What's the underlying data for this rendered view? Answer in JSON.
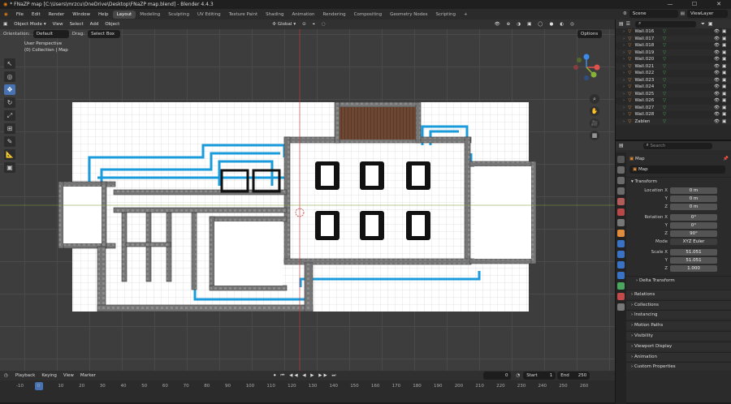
{
  "window": {
    "title": "* FNaZP map [C:\\Users\\mrzcu\\OneDrive\\Desktop\\FNaZP map.blend] - Blender 4.4.3"
  },
  "menu": [
    "File",
    "Edit",
    "Render",
    "Window",
    "Help"
  ],
  "workspaces": [
    "Layout",
    "Modeling",
    "Sculpting",
    "UV Editing",
    "Texture Paint",
    "Shading",
    "Animation",
    "Rendering",
    "Compositing",
    "Geometry Nodes",
    "Scripting",
    "+"
  ],
  "scene": {
    "name": "Scene",
    "view_layer": "ViewLayer"
  },
  "viewport_header": {
    "mode": "Object Mode",
    "view": "View",
    "select": "Select",
    "add": "Add",
    "object": "Object",
    "orientation_global": "Global"
  },
  "viewport_header2": {
    "orientation_label": "Orientation:",
    "orientation": "Default",
    "drag_label": "Drag:",
    "drag": "Select Box",
    "options": "Options"
  },
  "viewport_info": {
    "perspective": "User Perspective",
    "collection": "(0) Collection | Map"
  },
  "outliner": {
    "search_placeholder": "",
    "items": [
      "Wall.016",
      "Wall.017",
      "Wall.018",
      "Wall.019",
      "Wall.020",
      "Wall.021",
      "Wall.022",
      "Wall.023",
      "Wall.024",
      "Wall.025",
      "Wall.026",
      "Wall.027",
      "Wall.028",
      "Zablen"
    ]
  },
  "properties": {
    "search_placeholder": "Search",
    "object_name": "Map",
    "data_name": "Map",
    "transform_label": "Transform",
    "location": {
      "label": "Location X",
      "x": "0 m",
      "y": "0 m",
      "z": "0 m"
    },
    "rotation": {
      "label": "Rotation X",
      "x": "0°",
      "y": "0°",
      "z": "90°"
    },
    "mode": {
      "label": "Mode",
      "value": "XYZ Euler"
    },
    "scale": {
      "label": "Scale X",
      "x": "51.051",
      "y": "51.051",
      "z": "1.000"
    },
    "axis": {
      "y": "Y",
      "z": "Z"
    },
    "panels": [
      "Delta Transform",
      "Relations",
      "Collections",
      "Instancing",
      "Motion Paths",
      "Visibility",
      "Viewport Display",
      "Animation",
      "Custom Properties"
    ]
  },
  "timeline": {
    "playback": "Playback",
    "keying": "Keying",
    "view": "View",
    "marker": "Marker",
    "current_frame": "0",
    "start_label": "Start",
    "start": "1",
    "end_label": "End",
    "end": "250",
    "ruler": [
      "-10",
      "0",
      "10",
      "20",
      "30",
      "40",
      "50",
      "60",
      "70",
      "80",
      "90",
      "100",
      "110",
      "120",
      "130",
      "140",
      "150",
      "160",
      "170",
      "180",
      "190",
      "200",
      "210",
      "220",
      "230",
      "240",
      "250",
      "260"
    ]
  },
  "colors": {
    "accent": "#4772b3",
    "wire_blue": "#1a9bdc",
    "origin_red": "#c53d3d",
    "grid": "#3d3d3d"
  }
}
